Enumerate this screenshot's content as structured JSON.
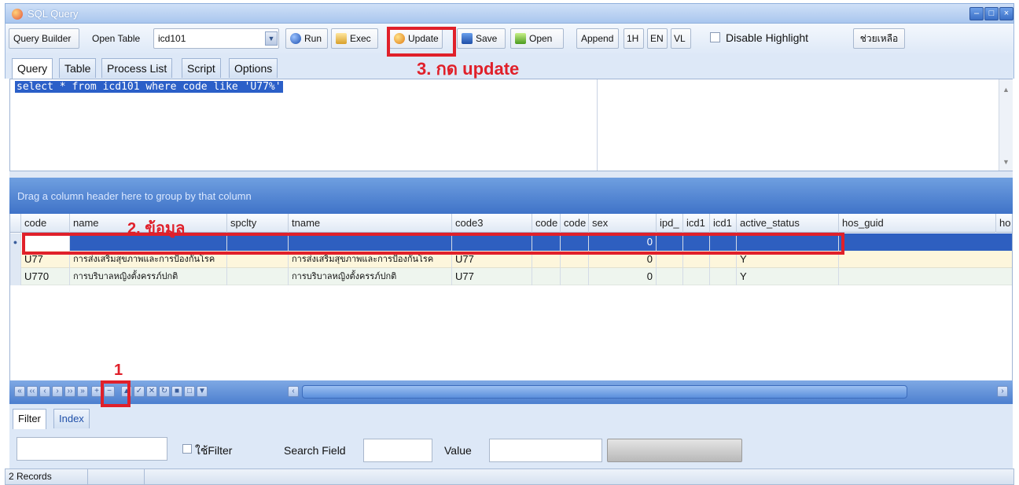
{
  "window": {
    "title": "SQL Query"
  },
  "toolbar": {
    "query_builder": "Query Builder",
    "open_table_label": "Open Table",
    "table_select_value": "icd101",
    "run": "Run",
    "exec": "Exec",
    "update": "Update",
    "save": "Save",
    "open": "Open",
    "append": "Append",
    "lang_1h": "1H",
    "lang_en": "EN",
    "lang_vl": "VL",
    "disable_highlight": "Disable Highlight",
    "help": "ช่วยเหลือ"
  },
  "tabs": [
    "Query",
    "Table",
    "Process List",
    "Script",
    "Options"
  ],
  "editor": {
    "sql": "select * from icd101 where code like 'U77%'"
  },
  "grid": {
    "group_hint": "Drag a column header here to group by that column",
    "columns": [
      "code",
      "name",
      "spclty",
      "tname",
      "code3",
      "code",
      "code",
      "sex",
      "ipd_",
      "icd1",
      "icd1",
      "active_status",
      "hos_guid",
      "ho"
    ],
    "rows": [
      {
        "code": "",
        "name": "",
        "spclty": "",
        "tname": "",
        "code3": "",
        "sex": "0",
        "active_status": ""
      },
      {
        "code": "U77",
        "name": "การส่งเสริมสุขภาพและการป้องกันโรค",
        "spclty": "",
        "tname": "การส่งเสริมสุขภาพและการป้องกันโรค",
        "code3": "U77",
        "sex": "0",
        "active_status": "Y"
      },
      {
        "code": "U770",
        "name": "การบริบาลหญิงตั้งครรภ์ปกติ",
        "spclty": "",
        "tname": "การบริบาลหญิงตั้งครรภ์ปกติ",
        "code3": "U77",
        "sex": "0",
        "active_status": "Y"
      }
    ]
  },
  "bottom_tabs": [
    "Filter",
    "Index"
  ],
  "filter": {
    "use_filter": "ใช้Filter",
    "search_field_label": "Search Field",
    "value_label": "Value"
  },
  "status": {
    "records": "2 Records"
  },
  "annotations": {
    "step1": "1",
    "step2": "2. ข้อมูล",
    "step3": "3. กด   update"
  },
  "colors": {
    "annotation_red": "#e0202a",
    "selected_row": "#2e5fc0",
    "odd_row": "#fdf6dc",
    "group_panel": "#4f80cf"
  }
}
